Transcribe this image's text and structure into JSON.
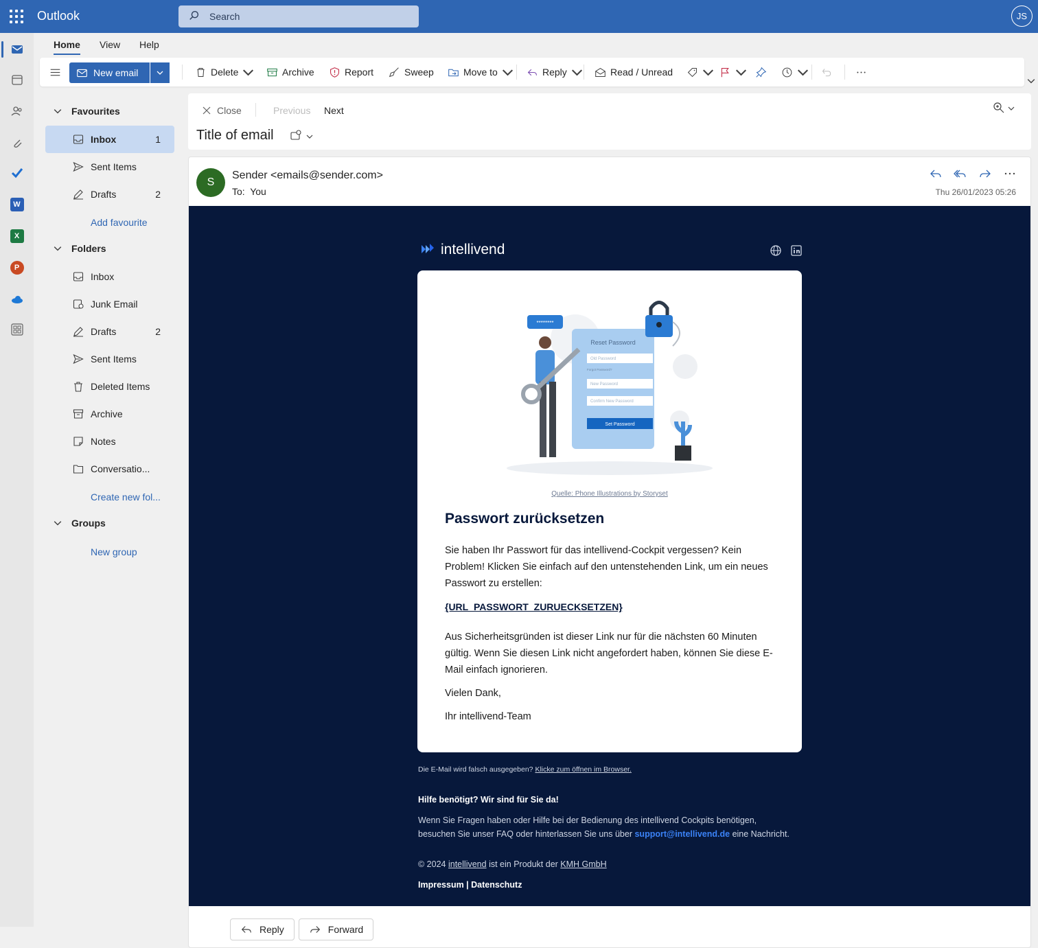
{
  "app": {
    "name": "Outlook",
    "user_initials": "JS"
  },
  "search": {
    "placeholder": "Search"
  },
  "ribbon_tabs": [
    "Home",
    "View",
    "Help"
  ],
  "ribbon": {
    "new_email": "New email",
    "delete": "Delete",
    "archive": "Archive",
    "report": "Report",
    "sweep": "Sweep",
    "move_to": "Move to",
    "reply": "Reply",
    "read_unread": "Read / Unread"
  },
  "sidebar": {
    "favourites": {
      "label": "Favourites",
      "items": [
        {
          "label": "Inbox",
          "count": "1"
        },
        {
          "label": "Sent Items",
          "count": ""
        },
        {
          "label": "Drafts",
          "count": "2"
        }
      ],
      "add_link": "Add favourite"
    },
    "folders": {
      "label": "Folders",
      "items": [
        {
          "label": "Inbox",
          "count": ""
        },
        {
          "label": "Junk Email",
          "count": ""
        },
        {
          "label": "Drafts",
          "count": "2"
        },
        {
          "label": "Sent Items",
          "count": ""
        },
        {
          "label": "Deleted Items",
          "count": ""
        },
        {
          "label": "Archive",
          "count": ""
        },
        {
          "label": "Notes",
          "count": ""
        },
        {
          "label": "Conversatio...",
          "count": ""
        }
      ],
      "create_link": "Create new fol..."
    },
    "groups": {
      "label": "Groups",
      "new_link": "New group"
    }
  },
  "reading": {
    "close": "Close",
    "previous": "Previous",
    "next": "Next",
    "title": "Title of email",
    "sender_initial": "S",
    "sender": "Sender <emails@sender.com>",
    "to_label": "To:",
    "to_value": "You",
    "date": "Thu 26/01/2023 05:26"
  },
  "email": {
    "brand": "intellivend",
    "illustration": {
      "password_dots": "********",
      "form_title": "Reset Password",
      "field_old": "Old Password",
      "forgot": "Forgot Password?",
      "field_new": "New Password",
      "field_confirm": "Confirm New Password",
      "button": "Set Password"
    },
    "credit": "Quelle: Phone Illustrations by Storyset",
    "heading": "Passwort zurücksetzen",
    "para1": "Sie haben Ihr Passwort für das intellivend-Cockpit vergessen? Kein Problem! Klicken Sie einfach auf den untenstehenden Link, um ein neues Passwort zu erstellen:",
    "link": "{URL_PASSWORT_ZURUECKSETZEN}",
    "para2": "Aus Sicherheitsgründen ist dieser Link nur für die nächsten 60 Minuten gültig. Wenn Sie diesen Link nicht angefordert haben, können Sie diese E-Mail einfach ignorieren.",
    "thanks": "Vielen Dank,",
    "signature": "Ihr intellivend-Team",
    "footer": {
      "broken_prefix": "Die E-Mail wird falsch ausgegeben?",
      "broken_link": "Klicke zum öffnen im Browser.",
      "help_title": "Hilfe benötigt? Wir sind für Sie da!",
      "help_line1": "Wenn Sie Fragen haben oder Hilfe bei der Bedienung des intellivend Cockpits benötigen,",
      "help_line2_prefix": "besuchen Sie unser FAQ oder hinterlassen Sie uns über",
      "support_email": "support@intellivend.de",
      "help_line2_suffix": "eine Nachricht.",
      "copyright_prefix": "© 2024",
      "copyright_brand": "intellivend",
      "copyright_mid": "ist ein Produkt der",
      "copyright_company": "KMH GmbH",
      "legal": "Impressum | Datenschutz"
    }
  },
  "bottom": {
    "reply": "Reply",
    "forward": "Forward"
  }
}
